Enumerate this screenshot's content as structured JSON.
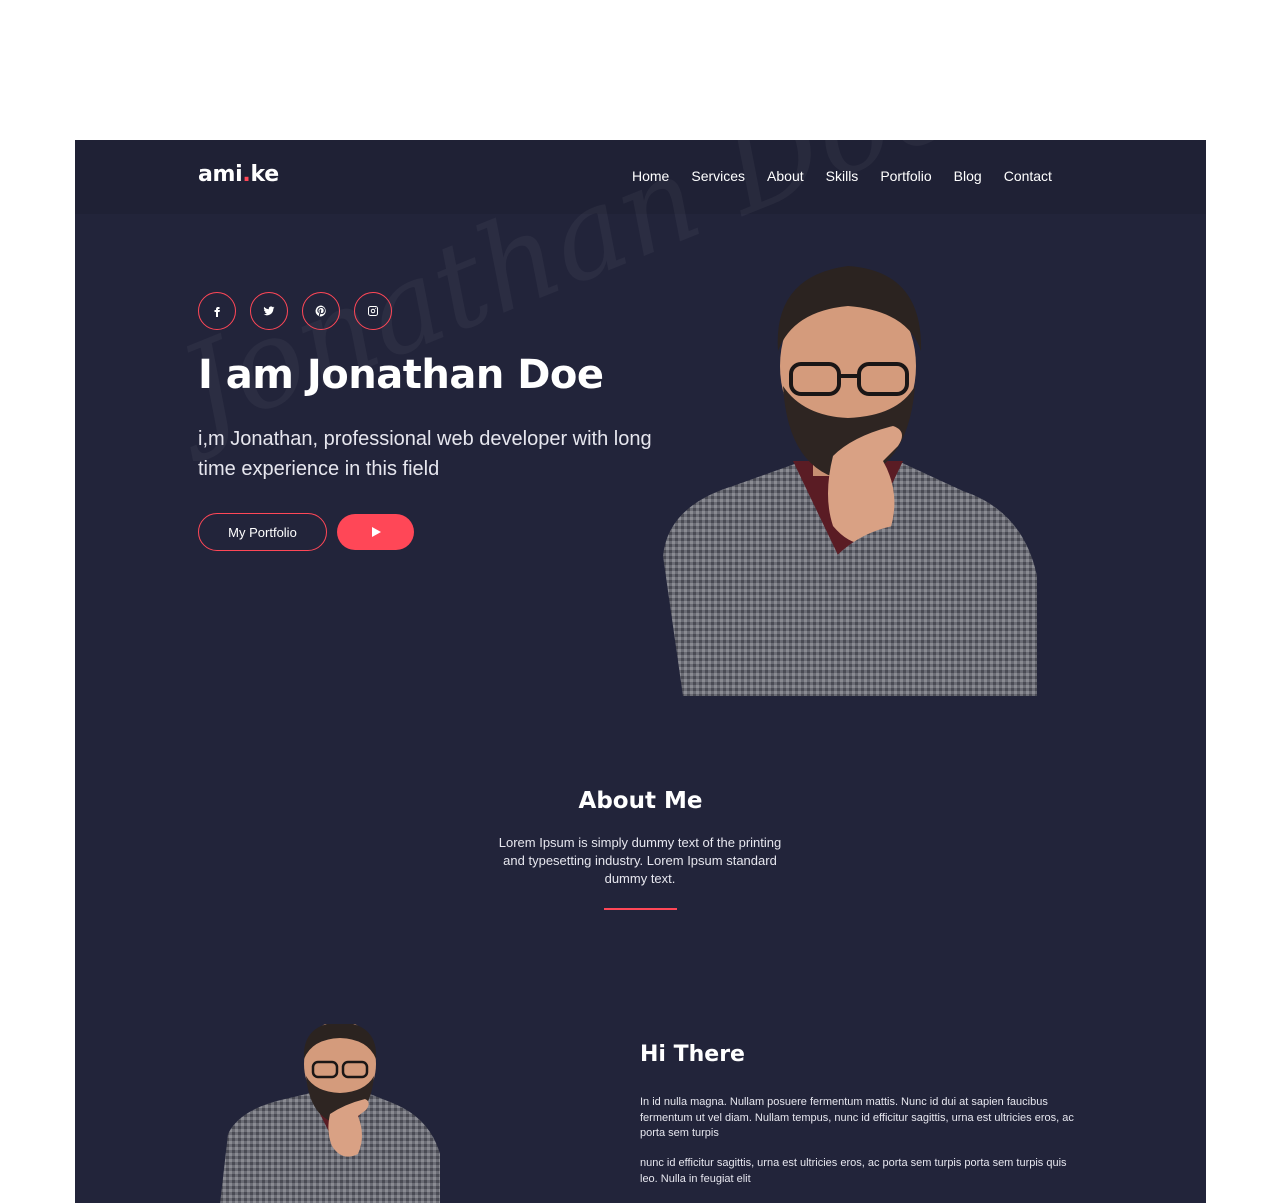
{
  "brand": {
    "logo_left": "ami",
    "logo_dot": ".",
    "logo_right": "ke"
  },
  "nav": {
    "items": [
      {
        "label": "Home"
      },
      {
        "label": "Services"
      },
      {
        "label": "About"
      },
      {
        "label": "Skills"
      },
      {
        "label": "Portfolio"
      },
      {
        "label": "Blog"
      },
      {
        "label": "Contact"
      }
    ]
  },
  "hero": {
    "socials": [
      "facebook-icon",
      "twitter-icon",
      "pinterest-icon",
      "instagram-icon"
    ],
    "title": "I am Jonathan Doe",
    "subtitle": "i,m Jonathan, professional web developer with long time experience in this field",
    "portfolio_button": "My Portfolio",
    "play_icon": "play-icon",
    "watermark": "Jonathan Doe"
  },
  "about": {
    "title": "About Me",
    "text": "Lorem Ipsum is simply dummy text of the printing and typesetting industry. Lorem Ipsum standard dummy text."
  },
  "intro": {
    "title": "Hi There",
    "paragraph1": "In id nulla magna. Nullam posuere fermentum mattis. Nunc id dui at sapien faucibus fermentum ut vel diam. Nullam tempus, nunc id efficitur sagittis, urna est ultricies eros, ac porta sem turpis",
    "paragraph2": "nunc id efficitur sagittis, urna est ultricies eros, ac porta sem turpis porta sem turpis quis leo. Nulla in feugiat elit"
  },
  "colors": {
    "accent": "#ff4757",
    "background": "#22243a",
    "navbar": "#1f2135",
    "text": "#ffffff"
  }
}
